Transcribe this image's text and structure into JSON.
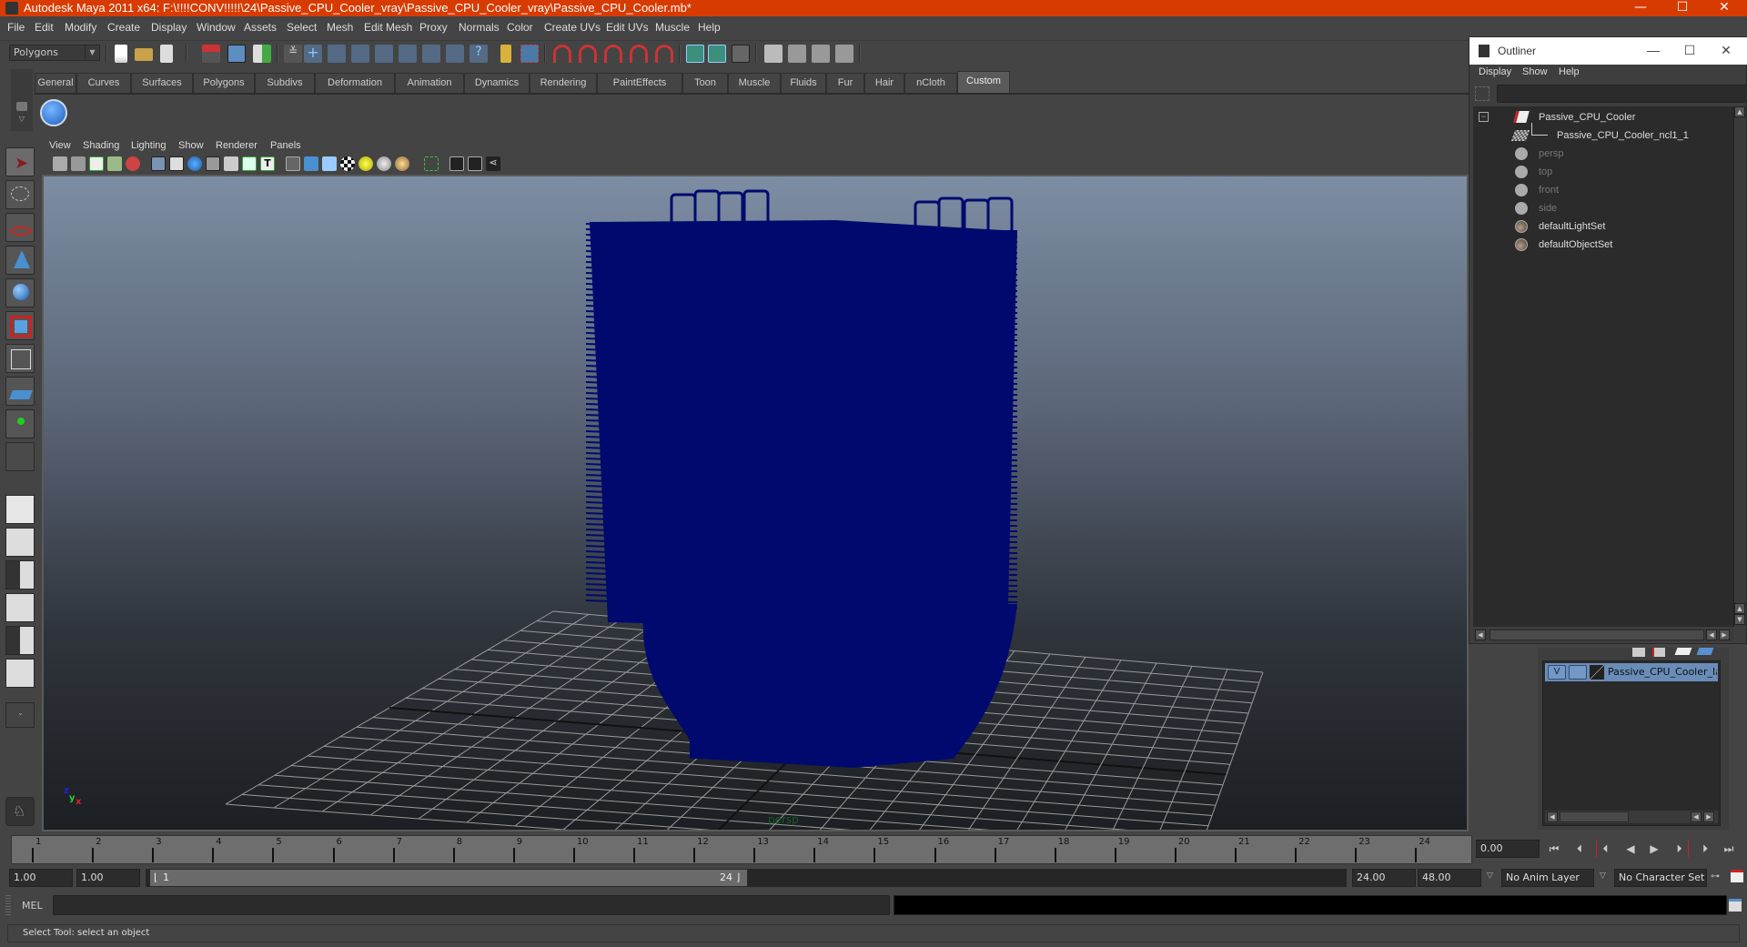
{
  "window": {
    "title": "Autodesk Maya 2011 x64: F:\\!!!!CONV!!!!!\\24\\Passive_CPU_Cooler_vray\\Passive_CPU_Cooler_vray\\Passive_CPU_Cooler.mb*",
    "controls": {
      "minimize": "—",
      "maximize": "☐",
      "close": "✕"
    }
  },
  "menubar": [
    "File",
    "Edit",
    "Modify",
    "Create",
    "Display",
    "Window",
    "Assets",
    "Select",
    "Mesh",
    "Edit Mesh",
    "Proxy",
    "Normals",
    "Color",
    "Create UVs",
    "Edit UVs",
    "Muscle",
    "Help"
  ],
  "status_line": {
    "mode": "Polygons",
    "icons": [
      "new-scene",
      "open-scene",
      "save-scene",
      "select-by-hierarchy",
      "select-by-object",
      "select-by-component",
      "lock-selection",
      "highlight-selection",
      "snap-grid",
      "snap-curve",
      "snap-point",
      "snap-surface",
      "construction-history",
      "render-current",
      "ipr-render",
      "render-settings",
      "show-hypershade",
      "render-view",
      "clapper-1",
      "clapper-2",
      "clapper-3"
    ]
  },
  "shelf": {
    "tabs": [
      "General",
      "Curves",
      "Surfaces",
      "Polygons",
      "Subdivs",
      "Deformation",
      "Animation",
      "Dynamics",
      "Rendering",
      "PaintEffects",
      "Toon",
      "Muscle",
      "Fluids",
      "Fur",
      "Hair",
      "nCloth",
      "Custom"
    ],
    "active_tab": "Custom",
    "items": [
      "checkmark-script"
    ]
  },
  "toolbox": {
    "tools": [
      "select-tool",
      "lasso-tool",
      "paint-select-tool",
      "move-tool",
      "rotate-tool",
      "scale-tool",
      "universal-manipulator",
      "soft-modification-tool",
      "show-manipulator",
      "last-tool"
    ],
    "active_tool": "select-tool",
    "layouts": [
      "single-perspective",
      "four-view",
      "outliner-perspective",
      "perspective-graph",
      "hypershade-perspective",
      "perspective-graph-hypergraph"
    ]
  },
  "viewport": {
    "menus": [
      "View",
      "Shading",
      "Lighting",
      "Show",
      "Renderer",
      "Panels"
    ],
    "camera_label": "persp",
    "axis": {
      "x": "x",
      "y": "y",
      "z": "z"
    },
    "wire_color": "#000a6e"
  },
  "outliner": {
    "title": "Outliner",
    "menus": [
      "Display",
      "Show",
      "Help"
    ],
    "filter_placeholder": "",
    "items": [
      {
        "name": "Passive_CPU_Cooler",
        "type": "transform",
        "dim": false,
        "expanded": true
      },
      {
        "name": "Passive_CPU_Cooler_ncl1_1",
        "type": "mesh",
        "dim": false,
        "child": true
      },
      {
        "name": "persp",
        "type": "camera",
        "dim": true
      },
      {
        "name": "top",
        "type": "camera",
        "dim": true
      },
      {
        "name": "front",
        "type": "camera",
        "dim": true
      },
      {
        "name": "side",
        "type": "camera",
        "dim": true
      },
      {
        "name": "defaultLightSet",
        "type": "set",
        "dim": false
      },
      {
        "name": "defaultObjectSet",
        "type": "set",
        "dim": false
      }
    ]
  },
  "layer_editor": {
    "layers": [
      {
        "visible": "V",
        "name": "Passive_CPU_Cooler_layer"
      }
    ]
  },
  "time_slider": {
    "ticks": [
      "1",
      "2",
      "3",
      "4",
      "5",
      "6",
      "7",
      "8",
      "9",
      "10",
      "11",
      "12",
      "13",
      "14",
      "15",
      "16",
      "17",
      "18",
      "19",
      "20",
      "21",
      "22",
      "23",
      "24"
    ],
    "current_time": "0.00",
    "playback": [
      "go-to-start",
      "step-back-frame",
      "step-back-key",
      "play-backward",
      "play-forward",
      "step-forward-key",
      "step-forward-frame",
      "go-to-end"
    ]
  },
  "range_slider": {
    "start_time": "1.00",
    "playback_start": "1.00",
    "range_start_label": "1",
    "range_end_label": "24",
    "playback_end": "24.00",
    "end_time": "48.00",
    "anim_layer": "No Anim Layer",
    "character_set": "No Character Set"
  },
  "command_line": {
    "label": "MEL",
    "value": "",
    "output": ""
  },
  "help_line": "Select Tool: select an object"
}
